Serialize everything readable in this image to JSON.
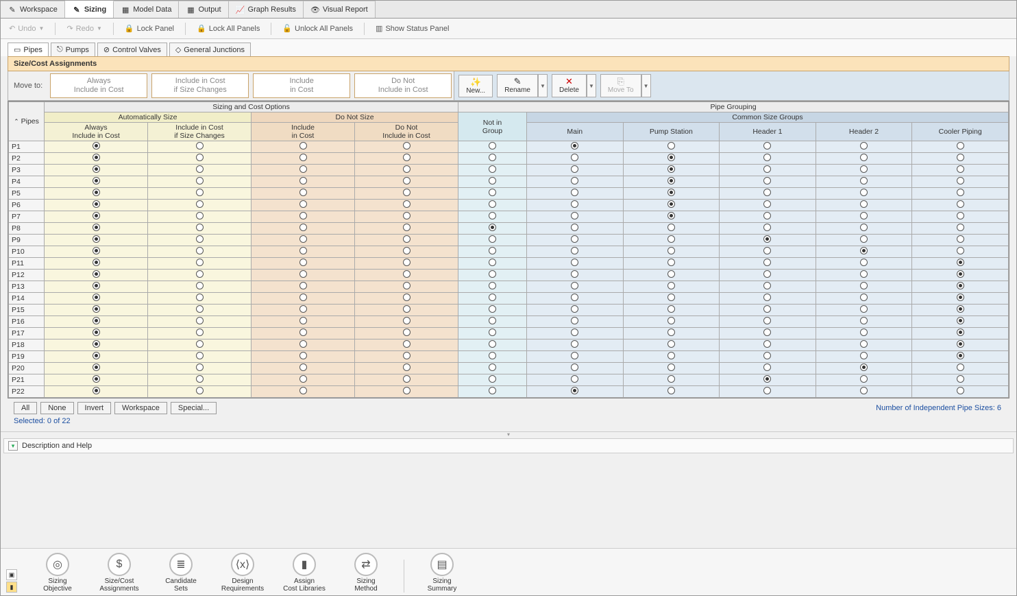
{
  "topTabs": [
    {
      "label": "Workspace",
      "active": false
    },
    {
      "label": "Sizing",
      "active": true
    },
    {
      "label": "Model Data",
      "active": false
    },
    {
      "label": "Output",
      "active": false
    },
    {
      "label": "Graph Results",
      "active": false
    },
    {
      "label": "Visual Report",
      "active": false
    }
  ],
  "toolbar": {
    "undo": "Undo",
    "redo": "Redo",
    "lockPanel": "Lock Panel",
    "lockAll": "Lock All Panels",
    "unlockAll": "Unlock All Panels",
    "showStatus": "Show Status Panel"
  },
  "subTabs": [
    {
      "label": "Pipes",
      "active": true
    },
    {
      "label": "Pumps",
      "active": false
    },
    {
      "label": "Control Valves",
      "active": false
    },
    {
      "label": "General Junctions",
      "active": false
    }
  ],
  "panelTitle": "Size/Cost Assignments",
  "moveTo": "Move to:",
  "moveBtns": [
    "Always\nInclude in Cost",
    "Include in Cost\nif Size Changes",
    "Include\nin Cost",
    "Do Not\nInclude in Cost"
  ],
  "actions": {
    "new": "New...",
    "rename": "Rename",
    "delete": "Delete",
    "moveTo": "Move To"
  },
  "headers": {
    "sizingCostOptions": "Sizing and Cost Options",
    "pipeGrouping": "Pipe Grouping",
    "pipes": "Pipes",
    "autoSize": "Automatically Size",
    "doNotSize": "Do Not Size",
    "notInGroup": "Not in\nGroup",
    "commonSizeGroups": "Common Size Groups",
    "alwaysInc": "Always\nInclude in Cost",
    "incIfChange": "Include in Cost\nif Size Changes",
    "incInCost": "Include\nin Cost",
    "doNotInc": "Do Not\nInclude in Cost"
  },
  "groups": [
    "Main",
    "Pump Station",
    "Header 1",
    "Header 2",
    "Cooler Piping"
  ],
  "rows": [
    {
      "id": "P1",
      "size": 0,
      "grp": "Main"
    },
    {
      "id": "P2",
      "size": 0,
      "grp": "Pump Station"
    },
    {
      "id": "P3",
      "size": 0,
      "grp": "Pump Station"
    },
    {
      "id": "P4",
      "size": 0,
      "grp": "Pump Station"
    },
    {
      "id": "P5",
      "size": 0,
      "grp": "Pump Station"
    },
    {
      "id": "P6",
      "size": 0,
      "grp": "Pump Station"
    },
    {
      "id": "P7",
      "size": 0,
      "grp": "Pump Station"
    },
    {
      "id": "P8",
      "size": 0,
      "grp": "NotIn"
    },
    {
      "id": "P9",
      "size": 0,
      "grp": "Header 1"
    },
    {
      "id": "P10",
      "size": 0,
      "grp": "Header 2"
    },
    {
      "id": "P11",
      "size": 0,
      "grp": "Cooler Piping"
    },
    {
      "id": "P12",
      "size": 0,
      "grp": "Cooler Piping"
    },
    {
      "id": "P13",
      "size": 0,
      "grp": "Cooler Piping"
    },
    {
      "id": "P14",
      "size": 0,
      "grp": "Cooler Piping"
    },
    {
      "id": "P15",
      "size": 0,
      "grp": "Cooler Piping"
    },
    {
      "id": "P16",
      "size": 0,
      "grp": "Cooler Piping"
    },
    {
      "id": "P17",
      "size": 0,
      "grp": "Cooler Piping"
    },
    {
      "id": "P18",
      "size": 0,
      "grp": "Cooler Piping"
    },
    {
      "id": "P19",
      "size": 0,
      "grp": "Cooler Piping"
    },
    {
      "id": "P20",
      "size": 0,
      "grp": "Header 2"
    },
    {
      "id": "P21",
      "size": 0,
      "grp": "Header 1"
    },
    {
      "id": "P22",
      "size": 0,
      "grp": "Main"
    }
  ],
  "selBtns": [
    "All",
    "None",
    "Invert",
    "Workspace",
    "Special..."
  ],
  "selectedInfo": "Selected: 0 of 22",
  "indLabel": "Number of Independent Pipe Sizes: 6",
  "descHelp": "Description and Help",
  "navItems": [
    {
      "label": "Sizing\nObjective",
      "icon": "◎"
    },
    {
      "label": "Size/Cost\nAssignments",
      "icon": "$"
    },
    {
      "label": "Candidate\nSets",
      "icon": "≣"
    },
    {
      "label": "Design\nRequirements",
      "icon": "⟨x⟩"
    },
    {
      "label": "Assign\nCost Libraries",
      "icon": "▮"
    },
    {
      "label": "Sizing\nMethod",
      "icon": "⇄"
    },
    {
      "label": "Sizing\nSummary",
      "icon": "▤",
      "after_sep": true
    }
  ]
}
